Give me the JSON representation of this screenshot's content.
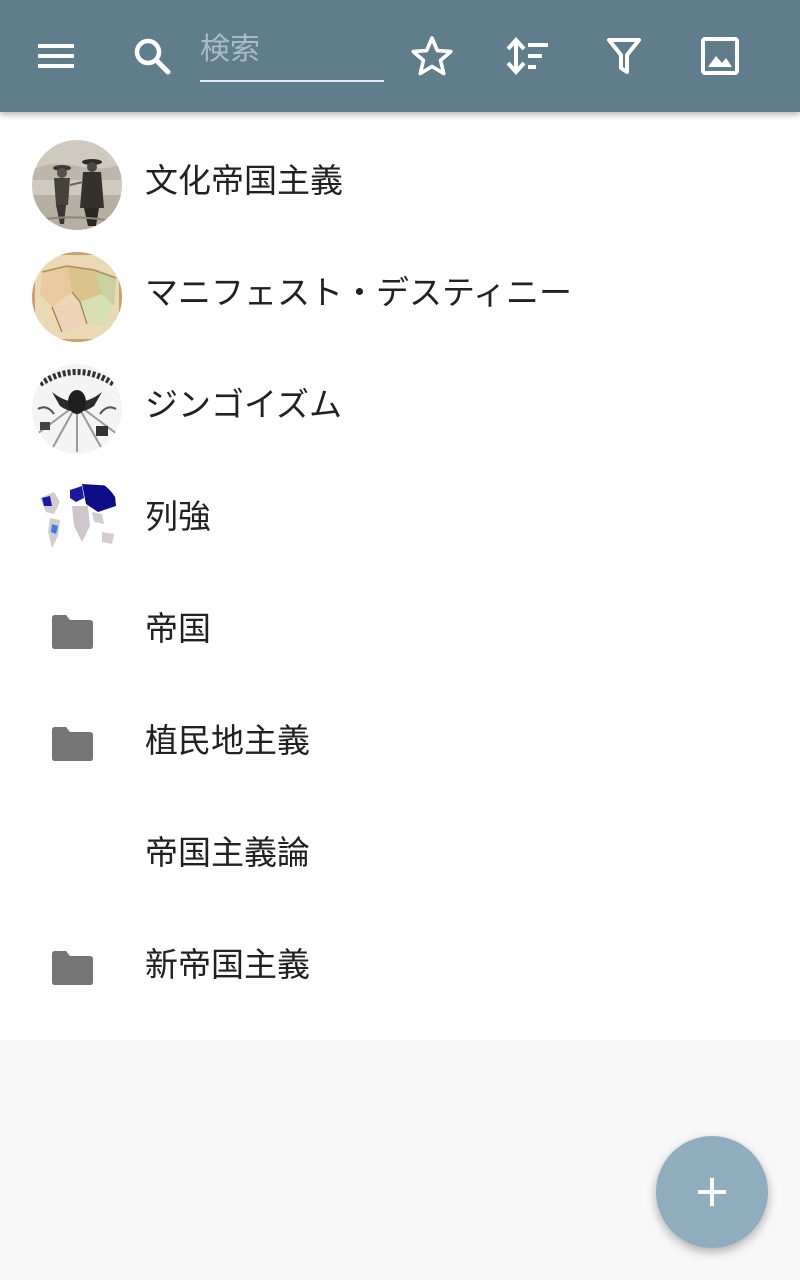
{
  "toolbar": {
    "background_color": "#607d8b",
    "menu_icon": "menu-icon",
    "search_icon": "search-icon",
    "search_placeholder": "検索",
    "search_value": "",
    "actions": [
      "star-outline-icon",
      "sort-icon",
      "filter-icon",
      "image-icon"
    ]
  },
  "list": {
    "items": [
      {
        "label": "文化帝国主義",
        "kind": "thumbnail",
        "thumbnail": "engraving-figures-thumbnail"
      },
      {
        "label": "マニフェスト・デスティニー",
        "kind": "thumbnail",
        "thumbnail": "old-map-thumbnail"
      },
      {
        "label": "ジンゴイズム",
        "kind": "thumbnail",
        "thumbnail": "eagle-illustration-thumbnail"
      },
      {
        "label": "列強",
        "kind": "thumbnail",
        "thumbnail": "world-map-thumbnail"
      },
      {
        "label": "帝国",
        "kind": "folder",
        "icon": "folder-icon"
      },
      {
        "label": "植民地主義",
        "kind": "folder",
        "icon": "folder-icon"
      },
      {
        "label": "帝国主義論",
        "kind": "none"
      },
      {
        "label": "新帝国主義",
        "kind": "folder",
        "icon": "folder-icon"
      }
    ]
  },
  "fab": {
    "icon": "plus-icon",
    "color": "#90adbd"
  },
  "colors": {
    "folder": "#757575",
    "text": "#212121",
    "background": "#f8f8f8"
  }
}
